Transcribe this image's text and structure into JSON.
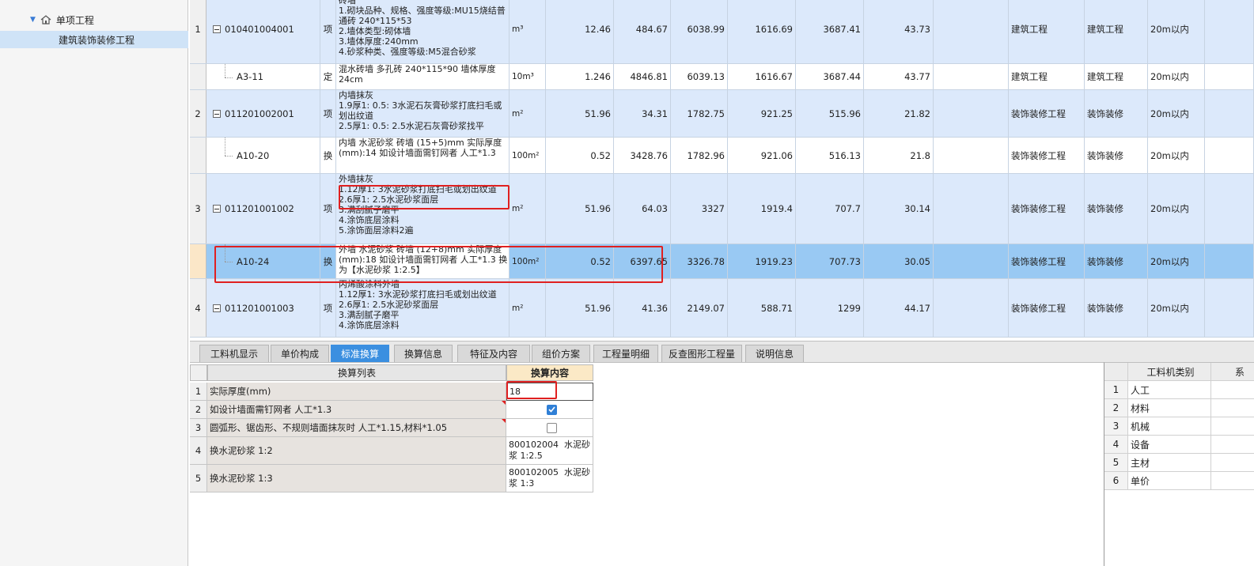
{
  "sidebar": {
    "root_label": "单项工程",
    "child_label": "建筑装饰装修工程"
  },
  "grid": {
    "rows": [
      {
        "idx": "1",
        "code": "010401004001",
        "type": "项",
        "name": "砖墙\n1.砌块品种、规格、强度等级:MU15烧结普通砖 240*115*53\n2.墙体类型:砌体墙\n3.墙体厚度:240mm\n4.砂浆种类、强度等级:M5混合砂浆",
        "unit": "m³",
        "qty": "12.46",
        "price": "484.67",
        "total": "6038.99",
        "labor": "1616.69",
        "material": "3687.41",
        "machine": "43.73",
        "x": "",
        "prof": "建筑工程",
        "prof2": "建筑工程",
        "height": "20m以内"
      },
      {
        "idx": "",
        "code": "A3-11",
        "type": "定",
        "name": "混水砖墙 多孔砖 240*115*90 墙体厚度 24cm",
        "unit": "10m³",
        "qty": "1.246",
        "price": "4846.81",
        "total": "6039.13",
        "labor": "1616.67",
        "material": "3687.44",
        "machine": "43.77",
        "x": "",
        "prof": "建筑工程",
        "prof2": "建筑工程",
        "height": "20m以内"
      },
      {
        "idx": "2",
        "code": "011201002001",
        "type": "项",
        "name": "内墙抹灰\n1.9厚1: 0.5: 3水泥石灰膏砂浆打底扫毛或划出纹道\n2.5厚1: 0.5: 2.5水泥石灰膏砂浆找平",
        "unit": "m²",
        "qty": "51.96",
        "price": "34.31",
        "total": "1782.75",
        "labor": "921.25",
        "material": "515.96",
        "machine": "21.82",
        "x": "",
        "prof": "装饰装修工程",
        "prof2": "装饰装修",
        "height": "20m以内"
      },
      {
        "idx": "",
        "code": "A10-20",
        "type": "换",
        "name": "内墙 水泥砂浆 砖墙 (15+5)mm 实际厚度(mm):14 如设计墙面需钉网者 人工*1.3",
        "unit": "100m²",
        "qty": "0.52",
        "price": "3428.76",
        "total": "1782.96",
        "labor": "921.06",
        "material": "516.13",
        "machine": "21.8",
        "x": "",
        "prof": "装饰装修工程",
        "prof2": "装饰装修",
        "height": "20m以内"
      },
      {
        "idx": "3",
        "code": "011201001002",
        "type": "项",
        "name": "外墙抹灰\n1.12厚1: 3水泥砂浆打底扫毛或划出纹道\n2.6厚1: 2.5水泥砂浆面层\n3.满刮腻子磨平\n4.涂饰底层涂料\n5.涂饰面层涂料2遍",
        "unit": "m²",
        "qty": "51.96",
        "price": "64.03",
        "total": "3327",
        "labor": "1919.4",
        "material": "707.7",
        "machine": "30.14",
        "x": "",
        "prof": "装饰装修工程",
        "prof2": "装饰装修",
        "height": "20m以内"
      },
      {
        "idx": "",
        "code": "A10-24",
        "type": "换",
        "name": "外墙 水泥砂浆 砖墙 (12+8)mm 实际厚度(mm):18 如设计墙面需钉网者 人工*1.3 换为【水泥砂浆 1:2.5】",
        "unit": "100m²",
        "qty": "0.52",
        "price": "6397.65",
        "total": "3326.78",
        "labor": "1919.23",
        "material": "707.73",
        "machine": "30.05",
        "x": "",
        "prof": "装饰装修工程",
        "prof2": "装饰装修",
        "height": "20m以内"
      },
      {
        "idx": "4",
        "code": "011201001003",
        "type": "项",
        "name": "丙烯酸涂料外墙\n1.12厚1: 3水泥砂浆打底扫毛或划出纹道\n2.6厚1: 2.5水泥砂浆面层\n3.满刮腻子磨平\n4.涂饰底层涂料",
        "unit": "m²",
        "qty": "51.96",
        "price": "41.36",
        "total": "2149.07",
        "labor": "588.71",
        "material": "1299",
        "machine": "44.17",
        "x": "",
        "prof": "装饰装修工程",
        "prof2": "装饰装修",
        "height": "20m以内"
      }
    ]
  },
  "tabs": [
    "工料机显示",
    "单价构成",
    "标准换算",
    "换算信息",
    "特征及内容",
    "组价方案",
    "工程量明细",
    "反查图形工程量",
    "说明信息"
  ],
  "active_tab": "标准换算",
  "conversion": {
    "header_list": "换算列表",
    "header_content": "换算内容",
    "rows": [
      {
        "idx": "1",
        "name": "实际厚度(mm)",
        "value": "18",
        "kind": "input"
      },
      {
        "idx": "2",
        "name": "如设计墙面需钉网者 人工*1.3",
        "value": "",
        "kind": "checkbox",
        "checked": true
      },
      {
        "idx": "3",
        "name": "圆弧形、锯齿形、不规则墙面抹灰时 人工*1.15,材料*1.05",
        "value": "",
        "kind": "checkbox",
        "checked": false
      },
      {
        "idx": "4",
        "name": "换水泥砂浆 1:2",
        "value": "800102004  水泥砂浆 1:2.5",
        "kind": "text"
      },
      {
        "idx": "5",
        "name": "换水泥砂浆 1:3",
        "value": "800102005  水泥砂浆 1:3",
        "kind": "text"
      }
    ]
  },
  "right_panel": {
    "header": "工料机类别",
    "header_extra": "系",
    "rows": [
      {
        "idx": "1",
        "name": "人工"
      },
      {
        "idx": "2",
        "name": "材料"
      },
      {
        "idx": "3",
        "name": "机械"
      },
      {
        "idx": "4",
        "name": "设备"
      },
      {
        "idx": "5",
        "name": "主材"
      },
      {
        "idx": "6",
        "name": "单价"
      }
    ]
  }
}
